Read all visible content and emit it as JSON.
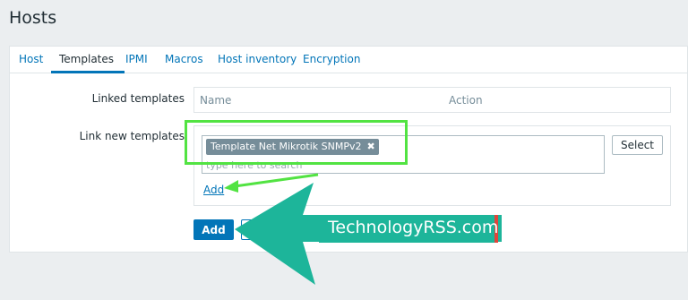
{
  "page": {
    "title": "Hosts"
  },
  "tabs": [
    {
      "label": "Host",
      "active": false
    },
    {
      "label": "Templates",
      "active": true
    },
    {
      "label": "IPMI",
      "active": false
    },
    {
      "label": "Macros",
      "active": false
    },
    {
      "label": "Host inventory",
      "active": false
    },
    {
      "label": "Encryption",
      "active": false
    }
  ],
  "linked_templates": {
    "label": "Linked templates",
    "columns": [
      "Name",
      "Action"
    ]
  },
  "link_new_templates": {
    "label": "Link new templates",
    "selected_chip": "Template Net Mikrotik SNMPv2",
    "chip_remove_glyph": "✖",
    "search_placeholder": "type here to search",
    "select_button": "Select",
    "add_link": "Add"
  },
  "form_buttons": {
    "add": "Add",
    "cancel": ""
  },
  "watermark": {
    "text": "TechnologyRSS.com"
  },
  "colors": {
    "accent": "#0275b8",
    "highlight": "#52e342",
    "watermark_bg": "#1db59a",
    "watermark_edge": "#e0443a"
  }
}
